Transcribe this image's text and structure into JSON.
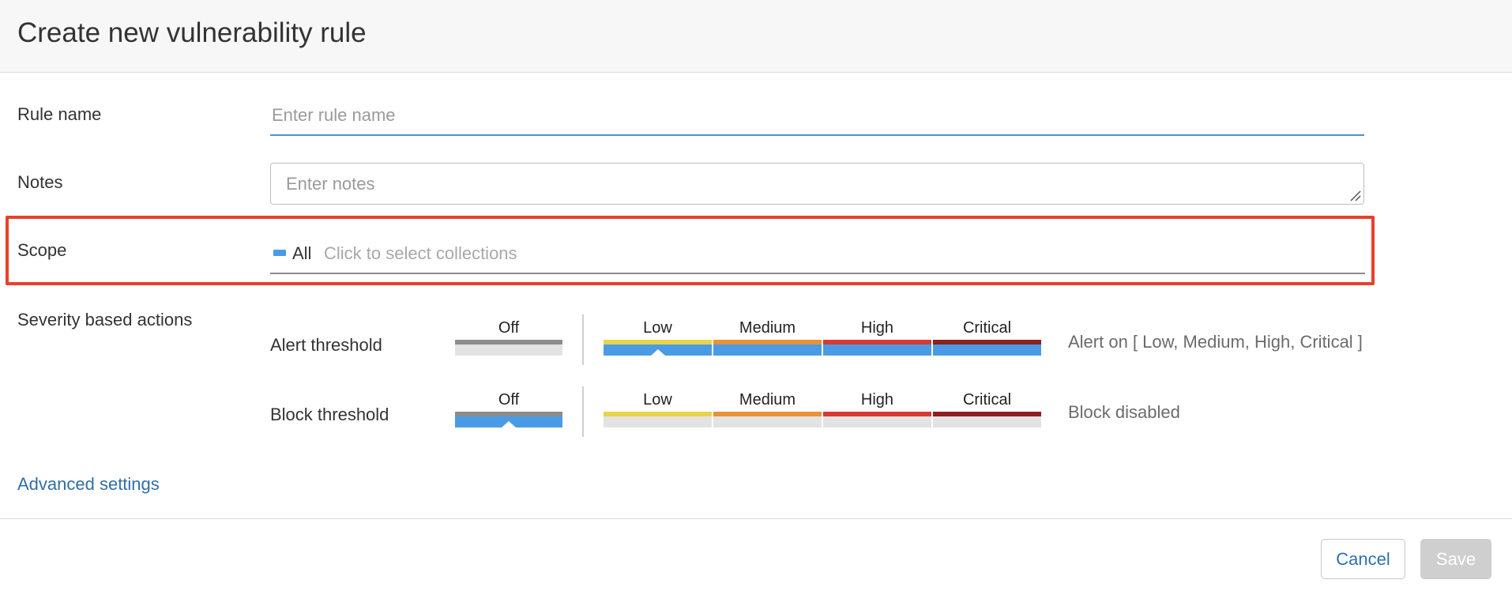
{
  "header": {
    "title": "Create new vulnerability rule"
  },
  "rule_name": {
    "label": "Rule name",
    "placeholder": "Enter rule name",
    "value": ""
  },
  "notes": {
    "label": "Notes",
    "placeholder": "Enter notes",
    "value": ""
  },
  "scope": {
    "label": "Scope",
    "selected": "All",
    "placeholder": "Click to select collections"
  },
  "severity": {
    "label": "Severity based actions",
    "levels": [
      "Off",
      "Low",
      "Medium",
      "High",
      "Critical"
    ],
    "level_colors": [
      "#8c8c8c",
      "#e8d44d",
      "#e8923a",
      "#d63a32",
      "#8c1f1f"
    ],
    "active_color": "#4a9be6",
    "inactive_color": "#e3e3e3",
    "alert": {
      "label": "Alert threshold",
      "selected": "Low",
      "status": "Alert on [ Low, Medium, High, Critical ]"
    },
    "block": {
      "label": "Block threshold",
      "selected": "Off",
      "status": "Block disabled"
    }
  },
  "advanced_settings": {
    "label": "Advanced settings"
  },
  "footer": {
    "cancel_label": "Cancel",
    "save_label": "Save"
  }
}
